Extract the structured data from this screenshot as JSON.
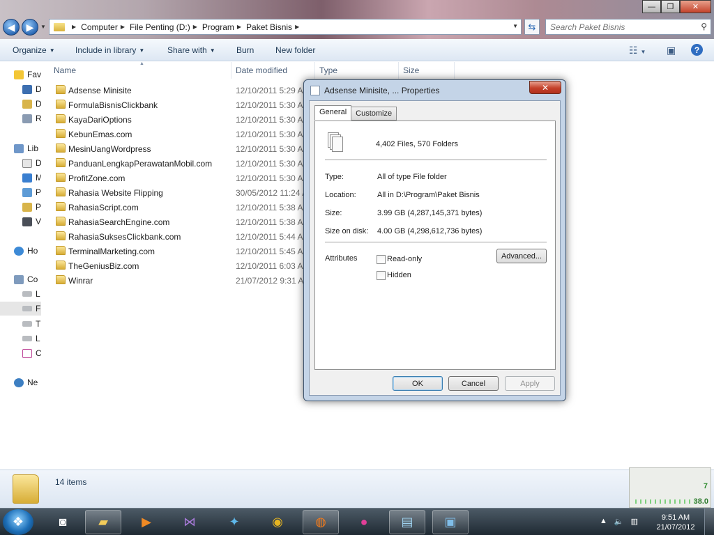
{
  "address": {
    "crumbs": [
      "Computer",
      "File Penting (D:)",
      "Program",
      "Paket Bisnis"
    ],
    "search_placeholder": "Search Paket Bisnis"
  },
  "window_controls": {
    "minimize": "—",
    "maximize": "❐",
    "close": "✕"
  },
  "toolbar": {
    "organize": "Organize",
    "include_in_library": "Include in library",
    "share_with": "Share with",
    "burn": "Burn",
    "new_folder": "New folder"
  },
  "nav_pane": {
    "items": [
      {
        "label": "Fav"
      },
      {
        "label": "D"
      },
      {
        "label": "D"
      },
      {
        "label": "R"
      },
      {
        "label": "Lib"
      },
      {
        "label": "D"
      },
      {
        "label": "M"
      },
      {
        "label": "P"
      },
      {
        "label": "P"
      },
      {
        "label": "V"
      },
      {
        "label": "Ho"
      },
      {
        "label": "Co"
      },
      {
        "label": "L"
      },
      {
        "label": "F"
      },
      {
        "label": "T"
      },
      {
        "label": "L"
      },
      {
        "label": "C"
      },
      {
        "label": "Ne"
      }
    ]
  },
  "columns": {
    "name": "Name",
    "date_modified": "Date modified",
    "type": "Type",
    "size": "Size"
  },
  "files": [
    {
      "name": "Adsense Minisite",
      "date": "12/10/2011 5:29 AM"
    },
    {
      "name": "FormulaBisnisClickbank",
      "date": "12/10/2011 5:30 AM"
    },
    {
      "name": "KayaDariOptions",
      "date": "12/10/2011 5:30 AM"
    },
    {
      "name": "KebunEmas.com",
      "date": "12/10/2011 5:30 AM"
    },
    {
      "name": "MesinUangWordpress",
      "date": "12/10/2011 5:30 AM"
    },
    {
      "name": "PanduanLengkapPerawatanMobil.com",
      "date": "12/10/2011 5:30 AM"
    },
    {
      "name": "ProfitZone.com",
      "date": "12/10/2011 5:30 AM"
    },
    {
      "name": "Rahasia Website Flipping",
      "date": "30/05/2012 11:24 AM"
    },
    {
      "name": "RahasiaScript.com",
      "date": "12/10/2011 5:38 AM"
    },
    {
      "name": "RahasiaSearchEngine.com",
      "date": "12/10/2011 5:38 AM"
    },
    {
      "name": "RahasiaSuksesClickbank.com",
      "date": "12/10/2011 5:44 AM"
    },
    {
      "name": "TerminalMarketing.com",
      "date": "12/10/2011 5:45 AM"
    },
    {
      "name": "TheGeniusBiz.com",
      "date": "12/10/2011 6:03 AM"
    },
    {
      "name": "Winrar",
      "date": "21/07/2012 9:31 AM"
    }
  ],
  "status": {
    "item_count": "14 items"
  },
  "gadget": {
    "value_top": "7",
    "value_bottom": "38.0"
  },
  "taskbar": {
    "clock_time": "9:51 AM",
    "clock_date": "21/07/2012"
  },
  "dialog": {
    "title": "Adsense Minisite, ... Properties",
    "close_glyph": "✕",
    "tabs": {
      "general": "General",
      "customize": "Customize"
    },
    "summary": "4,402 Files, 570 Folders",
    "type_label": "Type:",
    "type_value": "All of type File folder",
    "location_label": "Location:",
    "location_value": "All in D:\\Program\\Paket Bisnis",
    "size_label": "Size:",
    "size_value": "3.99 GB (4,287,145,371 bytes)",
    "size_on_disk_label": "Size on disk:",
    "size_on_disk_value": "4.00 GB (4,298,612,736 bytes)",
    "attributes_label": "Attributes",
    "readonly_label": "Read-only",
    "hidden_label": "Hidden",
    "advanced_button": "Advanced...",
    "ok_button": "OK",
    "cancel_button": "Cancel",
    "apply_button": "Apply"
  }
}
